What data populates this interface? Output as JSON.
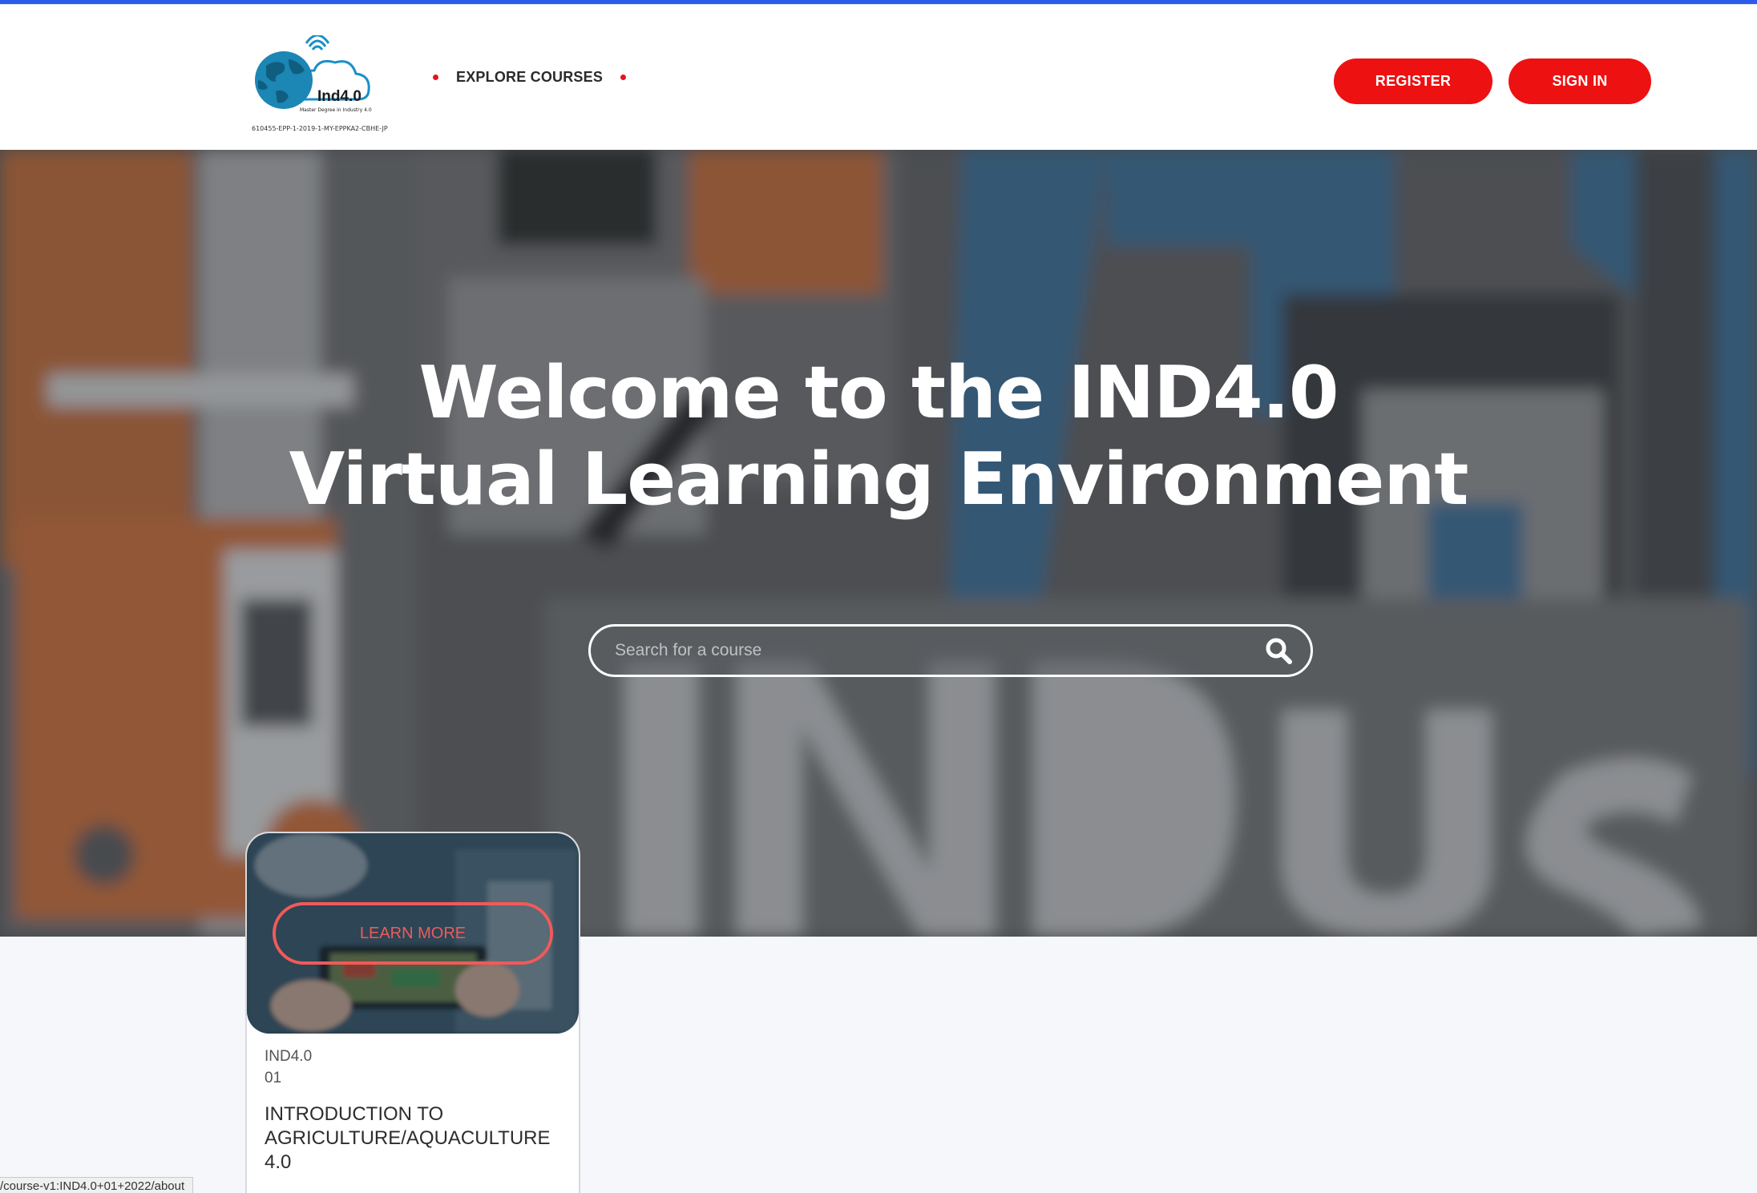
{
  "header": {
    "logo": {
      "wordmark": "Ind4.0",
      "subtitle": "Master Degree in Industry 4.0",
      "tagline": "610455-EPP-1-2019-1-MY-EPPKA2-CBHE-JP"
    },
    "nav": {
      "explore_courses": "EXPLORE COURSES"
    },
    "buttons": {
      "register": "REGISTER",
      "sign_in": "SIGN IN"
    }
  },
  "hero": {
    "title_line1": "Welcome to the IND4.0",
    "title_line2": "Virtual Learning Environment",
    "search": {
      "placeholder": "Search for a course",
      "value": ""
    }
  },
  "courses": [
    {
      "org": "IND4.0",
      "number": "01",
      "title": "INTRODUCTION TO AGRICULTURE/AQUACULTURE 4.0",
      "action": "LEARN MORE"
    }
  ],
  "status_bar": {
    "url": "/course-v1:IND4.0+01+2022/about"
  },
  "colors": {
    "accent": "#ee1111",
    "progress": "#2b5bea",
    "learn_more": "#f05a5a"
  },
  "icons": [
    "globe-logo-icon",
    "search-icon",
    "nav-dot-icon"
  ]
}
